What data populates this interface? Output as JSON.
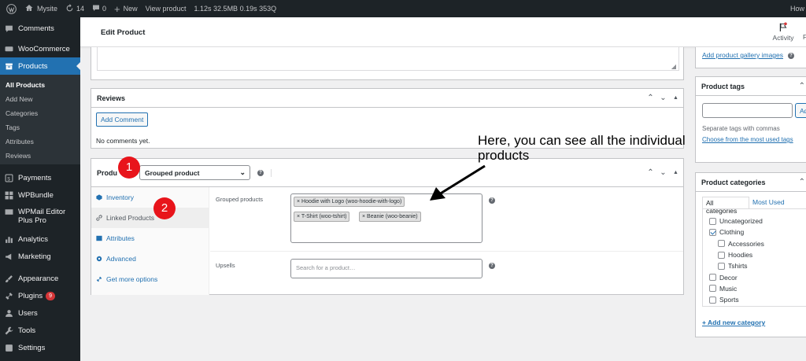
{
  "adminbar": {
    "site_name": "Mysite",
    "updates_count": "14",
    "comments_count": "0",
    "new_label": "New",
    "view_product": "View product",
    "perf": "1.12s  32.5MB  0.19s  353Q",
    "howdy": "How"
  },
  "sidebar": {
    "items_top": [
      {
        "label": "Comments",
        "icon": "comments-icon"
      }
    ],
    "woocommerce": "WooCommerce",
    "products": "Products",
    "submenu": [
      "All Products",
      "Add New",
      "Categories",
      "Tags",
      "Attributes",
      "Reviews"
    ],
    "items_bottom": [
      {
        "label": "Payments",
        "icon": "payments-icon"
      },
      {
        "label": "WPBundle",
        "icon": "grid-icon"
      },
      {
        "label": "WPMail Editor",
        "label2": "Plus Pro",
        "icon": "mail-icon"
      },
      {
        "label": "Analytics",
        "icon": "analytics-icon"
      },
      {
        "label": "Marketing",
        "icon": "megaphone-icon"
      },
      {
        "label": "Appearance",
        "icon": "brush-icon"
      },
      {
        "label": "Plugins",
        "icon": "plugin-icon",
        "badge": "9"
      },
      {
        "label": "Users",
        "icon": "users-icon"
      },
      {
        "label": "Tools",
        "icon": "wrench-icon"
      },
      {
        "label": "Settings",
        "icon": "settings-icon"
      }
    ]
  },
  "header": {
    "title": "Edit Product",
    "activity": "Activity"
  },
  "reviews": {
    "title": "Reviews",
    "add_comment": "Add Comment",
    "empty": "No comments yet."
  },
  "product_data": {
    "title_prefix": "Produ",
    "type_selected": "Grouped product",
    "tabs": [
      "Inventory",
      "Linked Products",
      "Attributes",
      "Advanced",
      "Get more options"
    ],
    "grouped_label": "Grouped products",
    "grouped_items": [
      "× Hoodie with Logo (woo-hoodie-with-logo)",
      "× T-Shirt (woo-tshirt)",
      "× Beanie (woo-beanie)"
    ],
    "upsells_label": "Upsells",
    "upsells_placeholder": "Search for a product…"
  },
  "annotation": {
    "text1": "Here, you can see all the individual",
    "text2": "products",
    "marker1": "1",
    "marker2": "2"
  },
  "right_panel": {
    "gallery_link": "Add product gallery images",
    "tags_title": "Product tags",
    "tags_add": "Ad",
    "tags_hint": "Separate tags with commas",
    "tags_choose": "Choose from the most used tags",
    "cats_title": "Product categories",
    "cats_tab_all": "All categories",
    "cats_tab_used": "Most Used",
    "categories": [
      "Uncategorized",
      "Clothing",
      "Accessories",
      "Hoodies",
      "Tshirts",
      "Decor",
      "Music",
      "Sports"
    ],
    "add_category": "+ Add new category"
  }
}
